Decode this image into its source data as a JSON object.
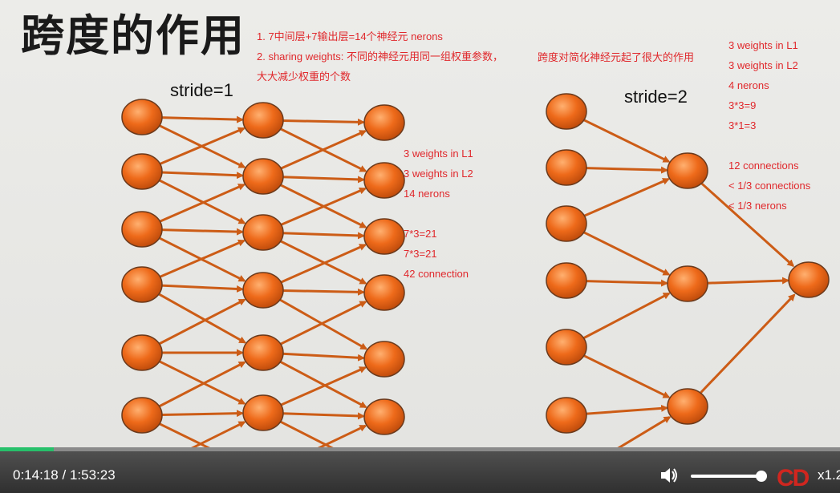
{
  "slide": {
    "title": "跨度的作用",
    "stride_left": "stride=1",
    "stride_right": "stride=2",
    "top_notes": [
      "1. 7中间层+7输出层=14个神经元 nerons",
      "2. sharing weights: 不同的神经元用同一组权重参数，",
      "大大减少权重的个数"
    ],
    "middle_note": "跨度对简化神经元起了很大的作用",
    "left_notes": [
      "3 weights in L1",
      "3 weights in L2",
      "14 nerons",
      "",
      "7*3=21",
      "7*3=21",
      "42 connection"
    ],
    "right_notes": [
      "3 weights in L1",
      "3 weights in L2",
      "4 nerons",
      "3*3=9",
      "3*1=3",
      "",
      "12 connections",
      "< 1/3 connections",
      "< 1/3 nerons"
    ],
    "colors": {
      "node": "#ee6a1a",
      "edge": "#cc5c16",
      "note": "#e0282c"
    }
  },
  "player": {
    "current_time": "0:14:18",
    "separator": "/",
    "total_time": "1:53:23",
    "progress": 0.064,
    "volume": 1.0,
    "volume_icon": "speaker-icon",
    "logo_text": "CD",
    "speed": "x1.2"
  }
}
